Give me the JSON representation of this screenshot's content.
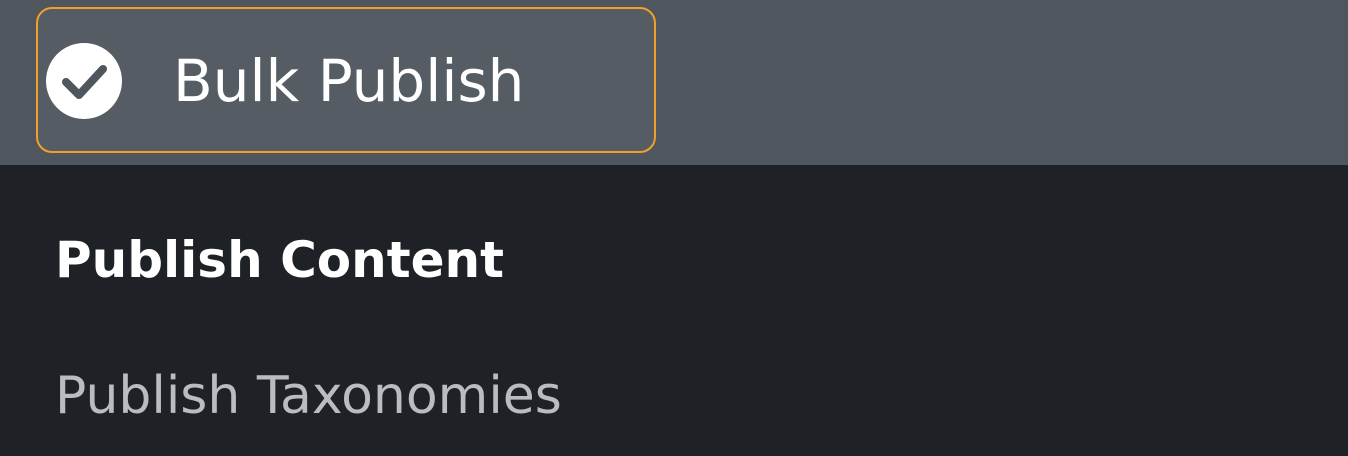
{
  "menu": {
    "active_item": {
      "label": "Bulk Publish",
      "icon": "checkmark-circle-icon"
    },
    "submenu": [
      {
        "label": "Publish Content",
        "current": true
      },
      {
        "label": "Publish Taxonomies",
        "current": false
      }
    ]
  },
  "colors": {
    "accent_border": "#f0a12b",
    "topbar_bg": "#50565d",
    "submenu_bg": "#1e2226",
    "muted_text": "#b9bcc0"
  }
}
